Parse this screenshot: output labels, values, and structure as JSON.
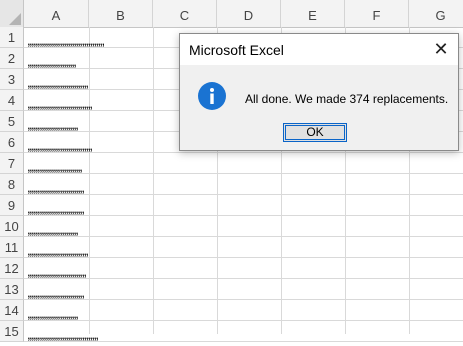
{
  "columns": [
    "A",
    "B",
    "C",
    "D",
    "E",
    "F",
    "G"
  ],
  "rows": [
    "1",
    "2",
    "3",
    "4",
    "5",
    "6",
    "7",
    "8",
    "9",
    "10",
    "11",
    "12",
    "13",
    "14",
    "15"
  ],
  "cells_a": [
    ",,,,,,,,,,,,,,,,,,,,,,,,,,,,,,,,,,,,,,",
    ",,,,,,,,,,,,,,,,,,,,,,,,",
    ",,,,,,,,,,,,,,,,,,,,,,,,,,,,,,",
    ",,,,,,,,,,,,,,,,,,,,,,,,,,,,,,,,",
    ",,,,,,,,,,,,,,,,,,,,,,,,,",
    ",,,,,,,,,,,,,,,,,,,,,,,,,,,,,,,,",
    ",,,,,,,,,,,,,,,,,,,,,,,,,,,",
    ",,,,,,,,,,,,,,,,,,,,,,,,,,,,",
    ",,,,,,,,,,,,,,,,,,,,,,,,,,,,",
    ",,,,,,,,,,,,,,,,,,,,,,,,,",
    ",,,,,,,,,,,,,,,,,,,,,,,,,,,,,,",
    ",,,,,,,,,,,,,,,,,,,,,,,,,,,,,",
    ",,,,,,,,,,,,,,,,,,,,,,,,,,,,",
    ",,,,,,,,,,,,,,,,,,,,,,,,,",
    ",,,,,,,,,,,,,,,,,,,,,,,,,,,,,,,,,,,"
  ],
  "dialog": {
    "title": "Microsoft Excel",
    "close_glyph": "✕",
    "message": "All done. We made 374 replacements.",
    "ok_label": "OK",
    "icon": "info-icon"
  },
  "colors": {
    "info_blue": "#1a73d2",
    "ok_border": "#0a64c8"
  }
}
